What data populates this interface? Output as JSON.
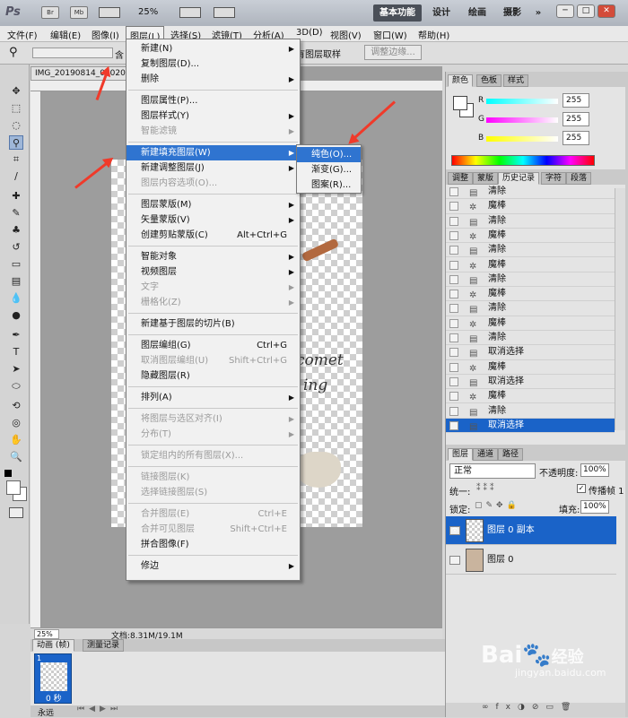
{
  "app": {
    "logo": "Ps"
  },
  "titlebar": {
    "zoom": "25%",
    "workspaces": [
      "基本功能",
      "设计",
      "绘画",
      "摄影"
    ],
    "more": "»",
    "window_buttons": [
      "─",
      "□",
      "✕"
    ],
    "mini_buttons": [
      "Br",
      "Mb"
    ]
  },
  "menubar": {
    "items": [
      "文件(F)",
      "编辑(E)",
      "图像(I)",
      "图层(L)",
      "选择(S)",
      "滤镜(T)",
      "分析(A)",
      "3D(D)",
      "视图(V)",
      "窗口(W)",
      "帮助(H)"
    ]
  },
  "options": {
    "sample_label_partial": "含",
    "sample_all_layers": "有图层取样",
    "refine_edge": "调整边缘..."
  },
  "document": {
    "tab_title": "IMG_20190814_08020",
    "zoom": "25%",
    "doc_size": "文档:8.31M/19.1M",
    "canvas_text_line1": "comet",
    "canvas_text_line2": "ing"
  },
  "layer_menu": {
    "items": [
      {
        "label": "新建(N)",
        "sub": true
      },
      {
        "label": "复制图层(D)..."
      },
      {
        "label": "删除",
        "sub": true
      },
      {
        "sep": true
      },
      {
        "label": "图层属性(P)..."
      },
      {
        "label": "图层样式(Y)",
        "sub": true
      },
      {
        "label": "智能滤镜",
        "disabled": true,
        "sub": true
      },
      {
        "sep": true
      },
      {
        "label": "新建填充图层(W)",
        "sub": true,
        "highlight": true
      },
      {
        "label": "新建调整图层(J)",
        "sub": true
      },
      {
        "label": "图层内容选项(O)...",
        "disabled": true
      },
      {
        "sep": true
      },
      {
        "label": "图层蒙版(M)",
        "sub": true
      },
      {
        "label": "矢量蒙版(V)",
        "sub": true
      },
      {
        "label": "创建剪贴蒙版(C)",
        "shortcut": "Alt+Ctrl+G"
      },
      {
        "sep": true
      },
      {
        "label": "智能对象",
        "sub": true
      },
      {
        "label": "视频图层",
        "sub": true
      },
      {
        "label": "文字",
        "disabled": true,
        "sub": true
      },
      {
        "label": "栅格化(Z)",
        "disabled": true,
        "sub": true
      },
      {
        "sep": true
      },
      {
        "label": "新建基于图层的切片(B)"
      },
      {
        "sep": true
      },
      {
        "label": "图层编组(G)",
        "shortcut": "Ctrl+G"
      },
      {
        "label": "取消图层编组(U)",
        "shortcut": "Shift+Ctrl+G",
        "disabled": true
      },
      {
        "label": "隐藏图层(R)"
      },
      {
        "sep": true
      },
      {
        "label": "排列(A)",
        "sub": true
      },
      {
        "sep": true
      },
      {
        "label": "将图层与选区对齐(I)",
        "disabled": true,
        "sub": true
      },
      {
        "label": "分布(T)",
        "disabled": true,
        "sub": true
      },
      {
        "sep": true
      },
      {
        "label": "锁定组内的所有图层(X)...",
        "disabled": true
      },
      {
        "sep": true
      },
      {
        "label": "链接图层(K)",
        "disabled": true
      },
      {
        "label": "选择链接图层(S)",
        "disabled": true
      },
      {
        "sep": true
      },
      {
        "label": "合并图层(E)",
        "shortcut": "Ctrl+E",
        "disabled": true
      },
      {
        "label": "合并可见图层",
        "shortcut": "Shift+Ctrl+E",
        "disabled": true
      },
      {
        "label": "拼合图像(F)"
      },
      {
        "sep": true
      },
      {
        "label": "修边",
        "sub": true
      }
    ]
  },
  "fill_submenu": {
    "items": [
      "纯色(O)...",
      "渐变(G)...",
      "图案(R)..."
    ],
    "highlight_index": 0
  },
  "color_panel": {
    "tabs": [
      "颜色",
      "色板",
      "样式"
    ],
    "channels": [
      {
        "label": "R",
        "value": "255"
      },
      {
        "label": "G",
        "value": "255"
      },
      {
        "label": "B",
        "value": "255"
      }
    ]
  },
  "history_panel": {
    "tabs": [
      "调整",
      "蒙版",
      "历史记录",
      "字符",
      "段落"
    ],
    "items": [
      "清除",
      "魔棒",
      "清除",
      "魔棒",
      "清除",
      "魔棒",
      "清除",
      "魔棒",
      "清除",
      "魔棒",
      "清除",
      "取消选择",
      "魔棒",
      "取消选择",
      "魔棒",
      "清除",
      "取消选择"
    ],
    "selected_index": 16
  },
  "layers_panel": {
    "tabs": [
      "图层",
      "通道",
      "路径"
    ],
    "blend_mode": "正常",
    "opacity_label": "不透明度:",
    "opacity": "100%",
    "unify_label": "统一:",
    "propagate_label": "传播帧 1",
    "lock_label": "锁定:",
    "fill_label": "填充:",
    "fill": "100%",
    "layers": [
      {
        "name": "图层 0 副本",
        "selected": true,
        "visible": true
      },
      {
        "name": "图层 0",
        "selected": false,
        "visible": false
      }
    ]
  },
  "animation_panel": {
    "tabs": [
      "动画 (帧)",
      "测量记录"
    ],
    "frame_number": "1",
    "frame_delay": "0 秒",
    "loop": "永远"
  },
  "watermark": {
    "brand": "Bai",
    "brand_cn": "经验",
    "url": "jingyan.baidu.com"
  }
}
